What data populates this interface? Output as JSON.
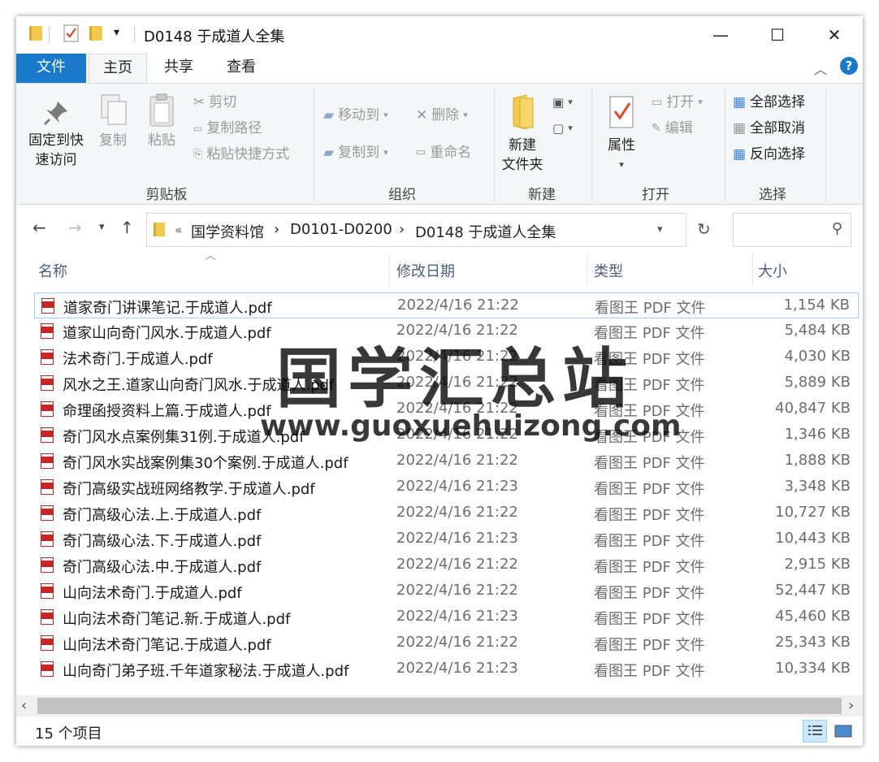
{
  "window": {
    "title": "D0148 于成道人全集",
    "controls": {
      "minimize": "—",
      "maximize": "☐",
      "close": "✕"
    }
  },
  "tabs": {
    "file": "文件",
    "home": "主页",
    "share": "共享",
    "view": "查看",
    "help": "?"
  },
  "ribbon": {
    "clipboard": {
      "label": "剪贴板",
      "pin_line1": "固定到快",
      "pin_line2": "速访问",
      "copy": "复制",
      "paste": "粘贴",
      "cut": "剪切",
      "copy_path": "复制路径",
      "paste_shortcut": "粘贴快捷方式"
    },
    "organize": {
      "label": "组织",
      "move_to": "移动到",
      "copy_to": "复制到",
      "delete": "删除",
      "rename": "重命名"
    },
    "new": {
      "label": "新建",
      "new_folder_line1": "新建",
      "new_folder_line2": "文件夹"
    },
    "open": {
      "label": "打开",
      "properties": "属性",
      "open": "打开",
      "edit": "编辑"
    },
    "select": {
      "label": "选择",
      "select_all": "全部选择",
      "select_none": "全部取消",
      "invert": "反向选择"
    }
  },
  "address": {
    "overflow": "«",
    "crumbs": [
      "国学资料馆",
      "D0101-D0200",
      "D0148 于成道人全集"
    ],
    "separator": "›"
  },
  "columns": {
    "name": "名称",
    "date": "修改日期",
    "type": "类型",
    "size": "大小"
  },
  "files": [
    {
      "name": "道家奇门讲课笔记.于成道人.pdf",
      "date": "2022/4/16 21:22",
      "type": "看图王 PDF 文件",
      "size": "1,154 KB"
    },
    {
      "name": "道家山向奇门风水.于成道人.pdf",
      "date": "2022/4/16 21:22",
      "type": "看图王 PDF 文件",
      "size": "5,484 KB"
    },
    {
      "name": "法术奇门.于成道人.pdf",
      "date": "2022/4/16 21:22",
      "type": "看图王 PDF 文件",
      "size": "4,030 KB"
    },
    {
      "name": "风水之王.道家山向奇门风水.于成道人.pdf",
      "date": "2022/4/16 21:22",
      "type": "看图王 PDF 文件",
      "size": "5,889 KB"
    },
    {
      "name": "命理函授资料上篇.于成道人.pdf",
      "date": "2022/4/16 21:22",
      "type": "看图王 PDF 文件",
      "size": "40,847 KB"
    },
    {
      "name": "奇门风水点案例集31例.于成道人.pdf",
      "date": "2022/4/16 21:22",
      "type": "看图王 PDF 文件",
      "size": "1,346 KB"
    },
    {
      "name": "奇门风水实战案例集30个案例.于成道人.pdf",
      "date": "2022/4/16 21:22",
      "type": "看图王 PDF 文件",
      "size": "1,888 KB"
    },
    {
      "name": "奇门高级实战班网络教学.于成道人.pdf",
      "date": "2022/4/16 21:23",
      "type": "看图王 PDF 文件",
      "size": "3,348 KB"
    },
    {
      "name": "奇门高级心法.上.于成道人.pdf",
      "date": "2022/4/16 21:22",
      "type": "看图王 PDF 文件",
      "size": "10,727 KB"
    },
    {
      "name": "奇门高级心法.下.于成道人.pdf",
      "date": "2022/4/16 21:23",
      "type": "看图王 PDF 文件",
      "size": "10,443 KB"
    },
    {
      "name": "奇门高级心法.中.于成道人.pdf",
      "date": "2022/4/16 21:22",
      "type": "看图王 PDF 文件",
      "size": "2,915 KB"
    },
    {
      "name": "山向法术奇门.于成道人.pdf",
      "date": "2022/4/16 21:22",
      "type": "看图王 PDF 文件",
      "size": "52,447 KB"
    },
    {
      "name": "山向法术奇门笔记.新.于成道人.pdf",
      "date": "2022/4/16 21:23",
      "type": "看图王 PDF 文件",
      "size": "45,460 KB"
    },
    {
      "name": "山向法术奇门笔记.于成道人.pdf",
      "date": "2022/4/16 21:22",
      "type": "看图王 PDF 文件",
      "size": "25,343 KB"
    },
    {
      "name": "山向奇门弟子班.千年道家秘法.于成道人.pdf",
      "date": "2022/4/16 21:23",
      "type": "看图王 PDF 文件",
      "size": "10,334 KB"
    }
  ],
  "watermark": {
    "title": "国学汇总站",
    "url": "www.guoxuehuizong.com"
  },
  "status": {
    "count": "15 个项目"
  },
  "colors": {
    "accent": "#1979ca",
    "selection_border": "#99d1ff",
    "pdf_red": "#c62828"
  },
  "icons": [
    "folder-icon",
    "properties-check-icon",
    "pin-icon",
    "copy-icon",
    "paste-icon",
    "scissors-icon",
    "move-icon",
    "delete-icon",
    "rename-icon",
    "new-folder-icon",
    "open-icon",
    "edit-icon",
    "select-all-icon",
    "pdf-file-icon",
    "search-icon",
    "refresh-icon"
  ]
}
